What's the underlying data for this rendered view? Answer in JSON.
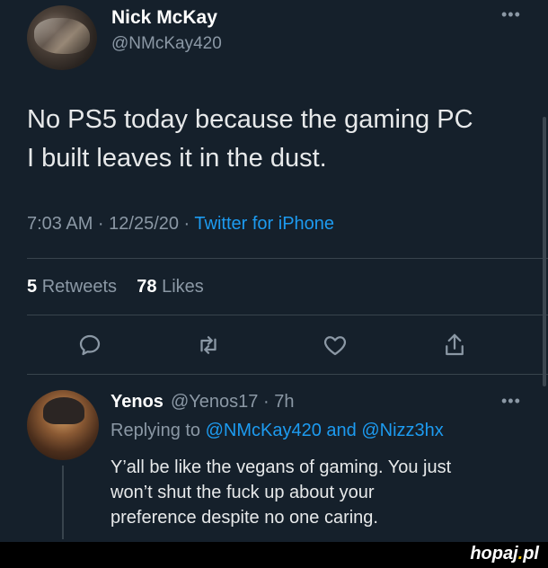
{
  "tweet": {
    "name": "Nick McKay",
    "handle": "@NMcKay420",
    "more": "•••",
    "text_line1": "No PS5 today because the gaming PC",
    "text_line2": "I built leaves it in the dust.",
    "time_date": "7:03 AM · 12/25/20 · ",
    "source": "Twitter for iPhone",
    "retweets_count": "5",
    "retweets_label": "Retweets",
    "likes_count": "78",
    "likes_label": "Likes"
  },
  "reply": {
    "name": "Yenos",
    "handle_time": "@Yenos17 · 7h",
    "more": "•••",
    "replying_prefix": "Replying to ",
    "mention1": "@NMcKay420",
    "and_word": " and ",
    "mention2": "@Nizz3hx",
    "text_line1": "Y’all be like the vegans of gaming. You just",
    "text_line2": "won’t shut the fuck up about your",
    "text_line3": "preference despite no one caring."
  },
  "footer": {
    "logo_main": "hopaj",
    "logo_dot": ".",
    "logo_tld": "pl"
  },
  "icons": {
    "reply": "reply-icon",
    "retweet": "retweet-icon",
    "like": "heart-icon",
    "share": "share-icon"
  },
  "colors": {
    "background": "#15202b",
    "link": "#1d9bf0",
    "muted": "#8b98a5",
    "divider": "#38444d"
  }
}
